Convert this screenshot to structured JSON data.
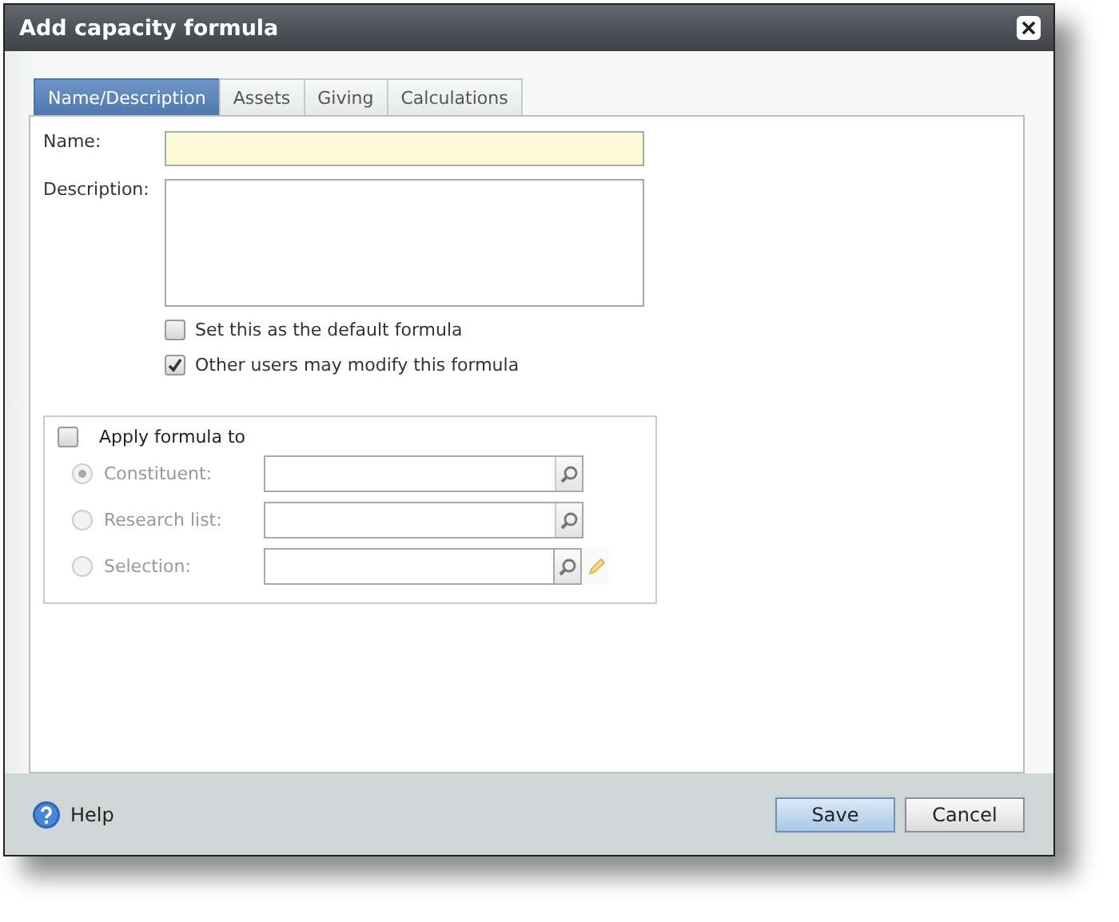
{
  "window": {
    "title": "Add capacity formula"
  },
  "tabs": [
    {
      "label": "Name/Description",
      "selected": true
    },
    {
      "label": "Assets",
      "selected": false
    },
    {
      "label": "Giving",
      "selected": false
    },
    {
      "label": "Calculations",
      "selected": false
    }
  ],
  "fields": [
    {
      "kind": "line",
      "label": "Name:"
    },
    {
      "kind": "area",
      "label": "Description:"
    }
  ],
  "options": [
    {
      "label": "Set this as the default formula",
      "checked": false
    },
    {
      "label": "Other users may modify this formula",
      "checked": true
    }
  ],
  "apply": {
    "label": "Apply formula to",
    "checked": false,
    "disabled": true,
    "targets": [
      {
        "label": "Constituent:",
        "selected": true,
        "kind": "search"
      },
      {
        "label": "Research list:",
        "selected": false,
        "kind": "search"
      },
      {
        "label": "Selection:",
        "selected": false,
        "kind": "search-edit"
      }
    ]
  },
  "footer": {
    "help": "Help",
    "buttons": [
      {
        "label": "Save",
        "default": true
      },
      {
        "label": "Cancel",
        "default": false
      }
    ]
  }
}
